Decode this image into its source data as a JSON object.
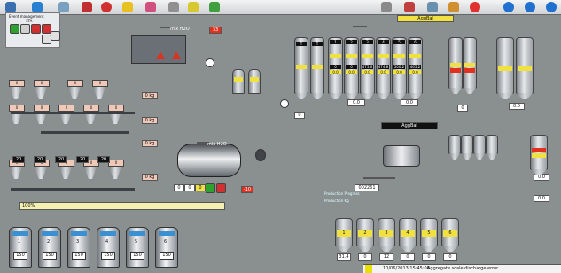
{
  "panel": {
    "title": "Event management",
    "sub": "STA"
  },
  "mixer_top_label": "mix H2O",
  "mixer_top_value": "33",
  "water_tag": "mix H2O",
  "aggr_label": "AggBal",
  "aggr_label2": "AggBal",
  "top_silos": [
    {
      "num": "1",
      "v1": "0",
      "v2": "0.0"
    },
    {
      "num": "2",
      "v1": "0",
      "v2": "0.0"
    },
    {
      "num": "3",
      "v1": "475.6",
      "v2": "0.0"
    },
    {
      "num": "4",
      "v1": "474.8",
      "v2": "0.0"
    },
    {
      "num": "5",
      "v1": "500.2",
      "v2": "0.0"
    },
    {
      "num": "6",
      "v1": "465.2",
      "v2": "0.0"
    }
  ],
  "scale_value": "0.0",
  "scale_value2": "0.0",
  "scale_value3": "0.0",
  "scale_value4": "0.0",
  "right_value1": "0",
  "right_value2": "0.0",
  "mid_value": "0",
  "small_hoppers": [
    "0",
    "0",
    "0",
    "0",
    "0",
    "0",
    "0",
    "0",
    "0",
    "0",
    "0",
    "0"
  ],
  "hopper_labels": [
    "0 kg",
    "0 kg",
    "0 kg",
    "0 kg"
  ],
  "readouts_mid": [
    "20",
    "20",
    "20",
    "20",
    "20"
  ],
  "mixer_values": [
    "0",
    "0",
    "0"
  ],
  "mixer_neg": "-10",
  "progress_label": "100%",
  "production_count": "002261",
  "production_label": "Production Progress",
  "production_label2": "Production Kg",
  "bottom_tanks": [
    {
      "num": "1",
      "val": "150"
    },
    {
      "num": "2",
      "val": "150"
    },
    {
      "num": "3",
      "val": "150"
    },
    {
      "num": "4",
      "val": "150"
    },
    {
      "num": "5",
      "val": "150"
    },
    {
      "num": "6",
      "val": "150"
    }
  ],
  "bottom_right_tanks": [
    "1",
    "2",
    "3",
    "4",
    "5",
    "6"
  ],
  "bottom_right_values": [
    "31.4",
    "0",
    "12",
    "0",
    "0",
    "0"
  ],
  "status_bar": {
    "datetime": "10/06/2013 15:45:08",
    "message": "Aggregate scale discharge error"
  },
  "colors": {
    "accent_yellow": "#f0e040",
    "alarm_red": "#e03020",
    "cyan": "#38c8e8",
    "bg": "#8a8f8f"
  }
}
